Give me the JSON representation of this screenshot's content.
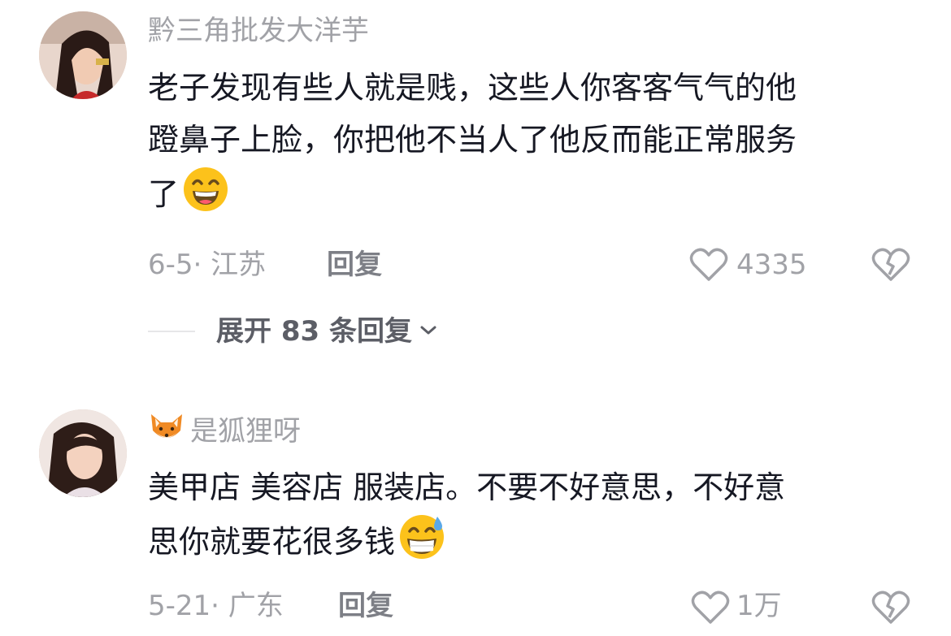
{
  "comments": [
    {
      "username": "黔三角批发大洋芋",
      "text_lines": [
        "老子发现有些人就是贱，这些人你客客气气的他",
        "蹬鼻子上脸，你把他不当人了他反而能正常服务",
        "了"
      ],
      "date_location": "6-5· 江苏",
      "reply_label": "回复",
      "like_count": "4335"
    },
    {
      "username": "是狐狸呀",
      "text_lines": [
        "美甲店 美容店 服装店。不要不好意思，不好意",
        "思你就要花很多钱"
      ],
      "date_location": "5-21· 广东",
      "reply_label": "回复",
      "like_count": "1万"
    }
  ],
  "expand_replies": "展开 83 条回复",
  "icons": {
    "like": "heart-outline-icon",
    "dislike": "broken-heart-outline-icon",
    "expand": "chevron-down-icon",
    "emoji1": "grinning-face-emoji",
    "emoji2": "grinning-sweat-emoji",
    "fox": "fox-face-emoji"
  }
}
